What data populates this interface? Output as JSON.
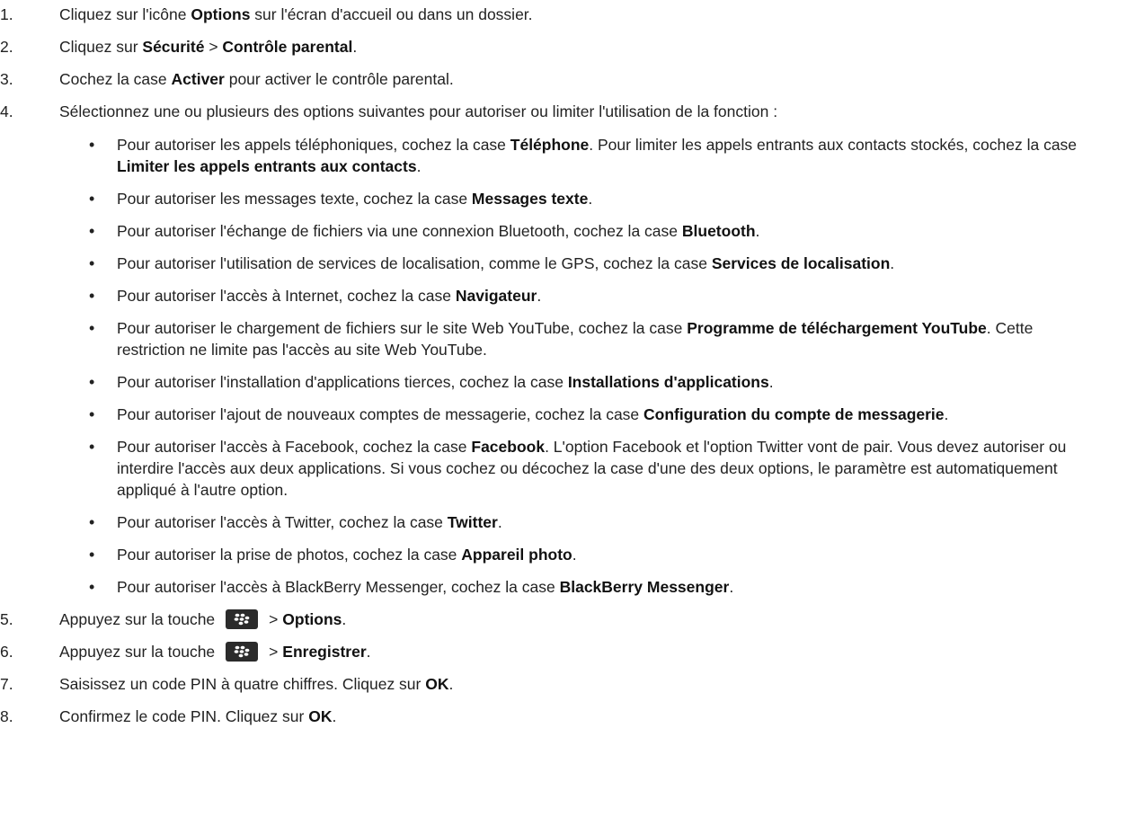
{
  "steps": [
    {
      "num": "1.",
      "parts": [
        {
          "t": "Cliquez sur l'icône "
        },
        {
          "t": "Options",
          "b": true
        },
        {
          "t": " sur l'écran d'accueil ou dans un dossier."
        }
      ]
    },
    {
      "num": "2.",
      "parts": [
        {
          "t": "Cliquez sur "
        },
        {
          "t": "Sécurité",
          "b": true
        },
        {
          "t": " > "
        },
        {
          "t": "Contrôle parental",
          "b": true
        },
        {
          "t": "."
        }
      ]
    },
    {
      "num": "3.",
      "parts": [
        {
          "t": "Cochez la case "
        },
        {
          "t": "Activer",
          "b": true
        },
        {
          "t": " pour activer le contrôle parental."
        }
      ]
    },
    {
      "num": "4.",
      "parts": [
        {
          "t": "Sélectionnez une ou plusieurs des options suivantes pour autoriser ou limiter l'utilisation de la fonction :"
        }
      ],
      "bullets": [
        [
          {
            "t": "Pour autoriser les appels téléphoniques, cochez la case "
          },
          {
            "t": "Téléphone",
            "b": true
          },
          {
            "t": ". Pour limiter les appels entrants aux contacts stockés, cochez la case "
          },
          {
            "t": "Limiter les appels entrants aux contacts",
            "b": true
          },
          {
            "t": "."
          }
        ],
        [
          {
            "t": "Pour autoriser les messages texte, cochez la case "
          },
          {
            "t": "Messages texte",
            "b": true
          },
          {
            "t": "."
          }
        ],
        [
          {
            "t": "Pour autoriser l'échange de fichiers via une connexion Bluetooth, cochez la case "
          },
          {
            "t": "Bluetooth",
            "b": true
          },
          {
            "t": "."
          }
        ],
        [
          {
            "t": "Pour autoriser l'utilisation de services de localisation, comme le GPS, cochez la case "
          },
          {
            "t": "Services de localisation",
            "b": true
          },
          {
            "t": "."
          }
        ],
        [
          {
            "t": "Pour autoriser l'accès à Internet, cochez la case "
          },
          {
            "t": "Navigateur",
            "b": true
          },
          {
            "t": "."
          }
        ],
        [
          {
            "t": "Pour autoriser le chargement de fichiers sur le site Web YouTube, cochez la case "
          },
          {
            "t": "Programme de téléchargement YouTube",
            "b": true
          },
          {
            "t": ". Cette restriction ne limite pas l'accès au site Web YouTube."
          }
        ],
        [
          {
            "t": "Pour autoriser l'installation d'applications tierces, cochez la case "
          },
          {
            "t": "Installations d'applications",
            "b": true
          },
          {
            "t": "."
          }
        ],
        [
          {
            "t": "Pour autoriser l'ajout de nouveaux comptes de messagerie, cochez la case "
          },
          {
            "t": "Configuration du compte de messagerie",
            "b": true
          },
          {
            "t": "."
          }
        ],
        [
          {
            "t": "Pour autoriser l'accès à Facebook, cochez la case "
          },
          {
            "t": "Facebook",
            "b": true
          },
          {
            "t": ". L'option Facebook et l'option Twitter vont de pair. Vous devez autoriser ou interdire l'accès aux deux applications. Si vous cochez ou décochez la case d'une des deux options, le paramètre est automatiquement appliqué à l'autre option."
          }
        ],
        [
          {
            "t": "Pour autoriser l'accès à Twitter, cochez la case "
          },
          {
            "t": "Twitter",
            "b": true
          },
          {
            "t": "."
          }
        ],
        [
          {
            "t": "Pour autoriser la prise de photos, cochez la case "
          },
          {
            "t": "Appareil photo",
            "b": true
          },
          {
            "t": "."
          }
        ],
        [
          {
            "t": "Pour autoriser l'accès à BlackBerry Messenger, cochez la case "
          },
          {
            "t": "BlackBerry Messenger",
            "b": true
          },
          {
            "t": "."
          }
        ]
      ]
    },
    {
      "num": "5.",
      "parts": [
        {
          "t": "Appuyez sur la touche"
        },
        {
          "key": "menu-key-icon"
        },
        {
          "t": "> "
        },
        {
          "t": "Options",
          "b": true
        },
        {
          "t": "."
        }
      ]
    },
    {
      "num": "6.",
      "parts": [
        {
          "t": "Appuyez sur la touche"
        },
        {
          "key": "menu-key-icon"
        },
        {
          "t": "> "
        },
        {
          "t": "Enregistrer",
          "b": true
        },
        {
          "t": "."
        }
      ]
    },
    {
      "num": "7.",
      "parts": [
        {
          "t": "Saisissez un code PIN à quatre chiffres. Cliquez sur "
        },
        {
          "t": "OK",
          "b": true
        },
        {
          "t": "."
        }
      ]
    },
    {
      "num": "8.",
      "parts": [
        {
          "t": "Confirmez le code PIN. Cliquez sur "
        },
        {
          "t": "OK",
          "b": true
        },
        {
          "t": "."
        }
      ]
    }
  ],
  "bullet_char": "•"
}
